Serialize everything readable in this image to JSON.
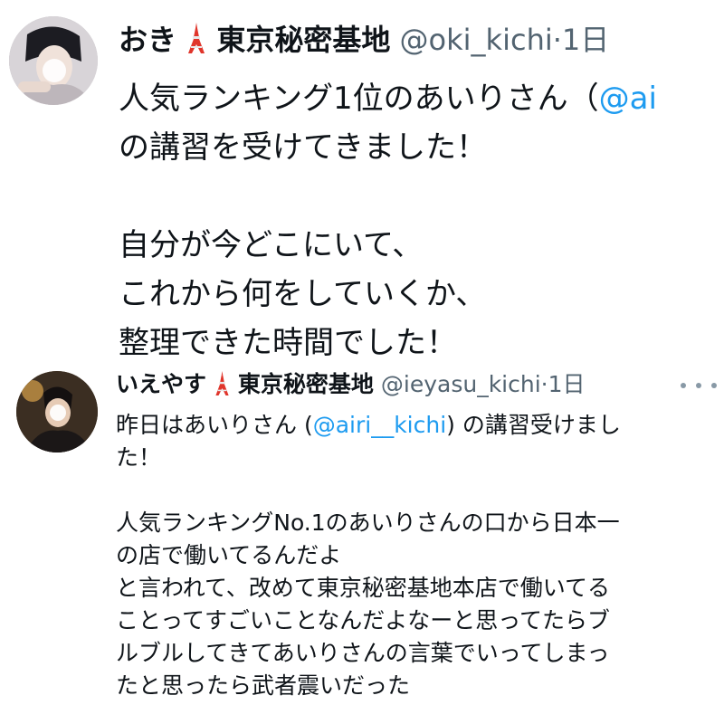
{
  "tweet_main": {
    "author_name": "おき",
    "author_group": "東京秘密基地",
    "handle": "@oki_kichi",
    "separator": "·",
    "time": "1日",
    "text_line1_before": "人気ランキング1位のあいりさん（",
    "text_line1_mention": "@ai",
    "text_line2": "の講習を受けてきました！",
    "text_line3": "自分が今どこにいて、",
    "text_line4": "これから何をしていくか、",
    "text_line5": "整理できた時間でした！"
  },
  "tweet_quoted": {
    "author_name": "いえやす",
    "author_group": "東京秘密基地",
    "handle": "@ieyasu_kichi",
    "separator": "·",
    "time": "1日",
    "text_line1_before": "昨日はあいりさん (",
    "text_line1_mention": "@airi__kichi",
    "text_line1_after": ") の講習受けまし",
    "text_line2": "た！",
    "text_line3": "人気ランキングNo.1のあいりさんの口から日本一",
    "text_line4": "の店で働いてるんだよ",
    "text_line5": "と言われて、改めて東京秘密基地本店で働いてる",
    "text_line6": "ことってすごいことなんだよなーと思ってたらブ",
    "text_line7": "ルブルしてきてあいりさんの言葉でいってしまっ",
    "text_line8": "たと思ったら武者震いだった"
  },
  "icons": {
    "tower": "tokyo-tower-icon",
    "more": "more-horizontal-icon"
  },
  "colors": {
    "text": "#0f1419",
    "secondary": "#536471",
    "mention": "#1d9bf0",
    "tower_red": "#e0352b"
  }
}
